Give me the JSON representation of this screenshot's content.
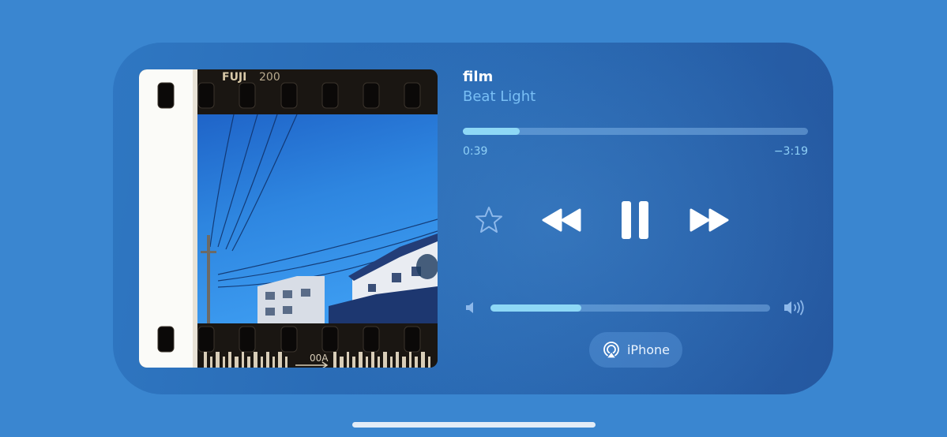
{
  "track": {
    "title": "film",
    "artist": "Beat Light"
  },
  "artwork": {
    "film_brand": "FUJI",
    "film_speed": "200",
    "frame_code": "00A"
  },
  "progress": {
    "elapsed": "0:39",
    "remaining": "−3:19",
    "fraction": 0.164
  },
  "controls": {
    "favorite_icon": "star-icon",
    "rewind_icon": "rewind-icon",
    "play_state_icon": "pause-icon",
    "forward_icon": "fast-forward-icon"
  },
  "volume": {
    "level": 0.325,
    "low_icon": "speaker-low-icon",
    "high_icon": "speaker-high-icon"
  },
  "output": {
    "device": "iPhone",
    "icon": "airplay-icon"
  },
  "colors": {
    "background": "#3a86d0",
    "accent": "#8ed8f6",
    "artist_text": "#79bff5"
  }
}
